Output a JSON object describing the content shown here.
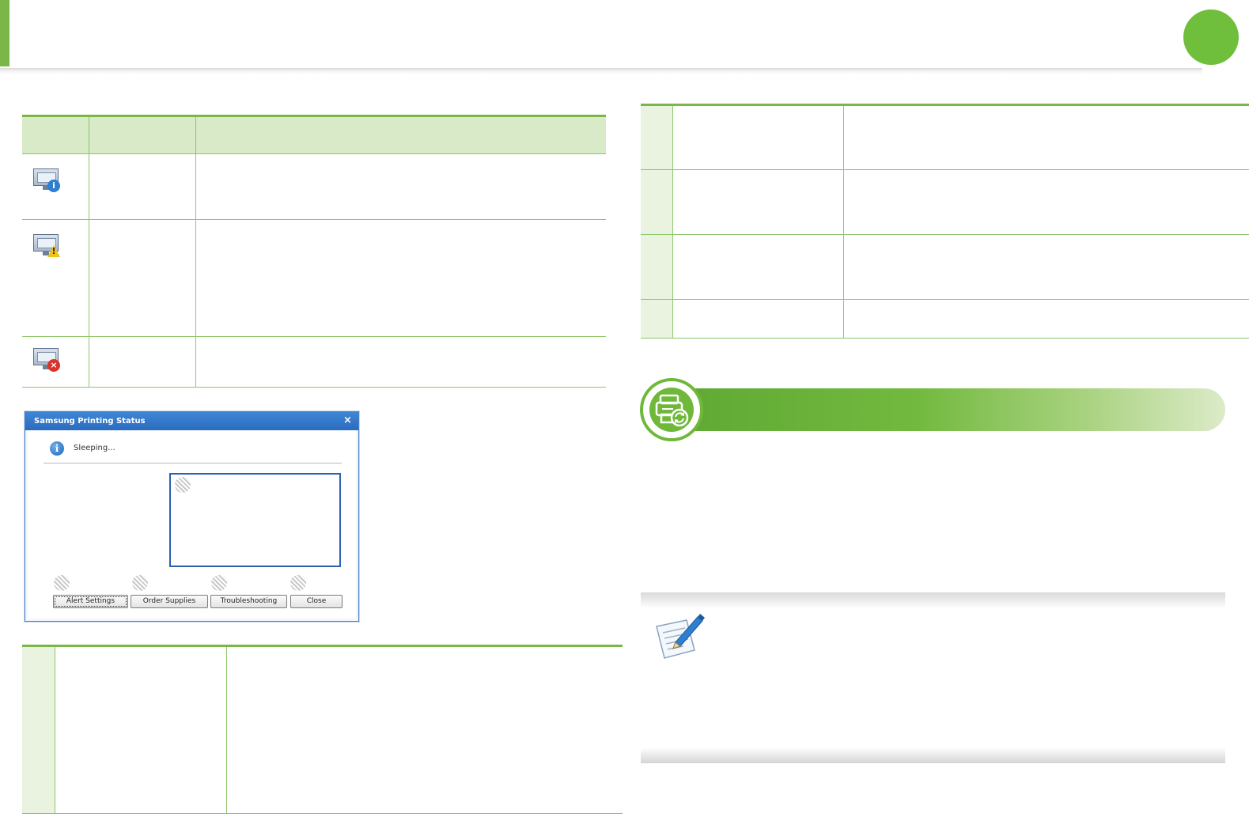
{
  "dialog": {
    "title": "Samsung Printing Status",
    "close_glyph": "×",
    "info_glyph": "i",
    "status": "Sleeping...",
    "buttons": {
      "alert_settings": "Alert Settings",
      "order_supplies": "Order Supplies",
      "troubleshooting": "Troubleshooting",
      "close": "Close"
    }
  },
  "status_icons": {
    "info": "i",
    "warning": "!",
    "error": "×"
  },
  "colors": {
    "accent_green": "#7ab648",
    "header_cell": "#d8eac8",
    "dialog_blue": "#2a6bbf"
  },
  "icons": [
    "monitor-info-icon",
    "monitor-warning-icon",
    "monitor-error-icon",
    "printer-refresh-icon",
    "note-pencil-icon"
  ]
}
